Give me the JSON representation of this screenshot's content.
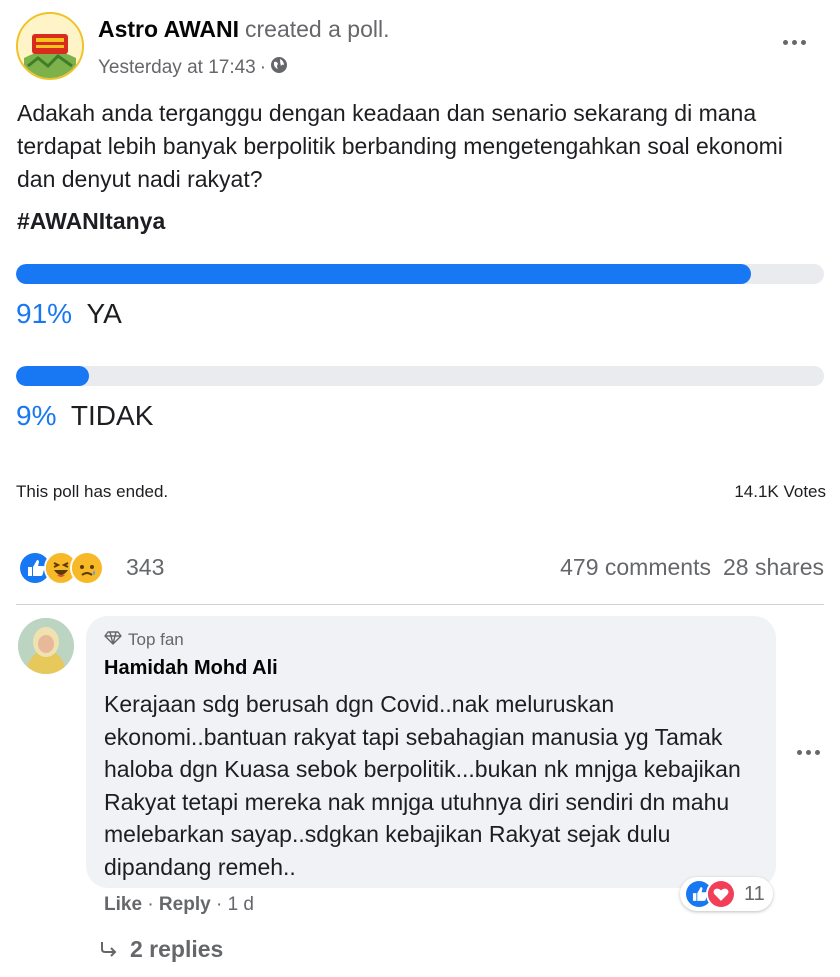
{
  "post": {
    "author": "Astro AWANI",
    "action": "created a poll.",
    "timestamp": "Yesterday at 17:43",
    "separator": "·",
    "privacy_icon": "globe-icon",
    "question": "Adakah anda terganggu dengan keadaan dan senario sekarang di mana terdapat lebih banyak berpolitik berbanding mengetengahkan soal ekonomi dan denyut nadi rakyat?",
    "hashtag": "#AWANItanya"
  },
  "poll": {
    "options": [
      {
        "percent_label": "91%",
        "label": "YA",
        "fraction": 0.91
      },
      {
        "percent_label": "9%",
        "label": "TIDAK",
        "fraction": 0.09
      }
    ],
    "status": "This poll has ended.",
    "votes": "14.1K Votes"
  },
  "engagement": {
    "reaction_icons": [
      "like-icon",
      "haha-icon",
      "sad-icon"
    ],
    "reaction_count": "343",
    "comments": "479 comments",
    "shares": "28 shares"
  },
  "comment": {
    "badge": "Top fan",
    "badge_icon": "diamond-icon",
    "author": "Hamidah Mohd Ali",
    "text": "Kerajaan sdg berusah dgn Covid..nak meluruskan ekonomi..bantuan rakyat tapi sebahagian manusia yg Tamak haloba dgn Kuasa sebok berpolitik...bukan nk mnjga kebajikan Rakyat tetapi mereka nak mnjga utuhnya diri sendiri dn mahu melebarkan sayap..sdgkan kebajikan Rakyat sejak dulu dipandang remeh..",
    "reaction_icons": [
      "like-icon",
      "love-icon"
    ],
    "reaction_count": "11",
    "like_label": "Like",
    "reply_label": "Reply",
    "age": "1 d",
    "replies_label": "2 replies"
  },
  "colors": {
    "accent": "#1877f2",
    "track": "#e9ebee",
    "bubble": "#f0f2f5",
    "muted_text": "#65676b"
  }
}
